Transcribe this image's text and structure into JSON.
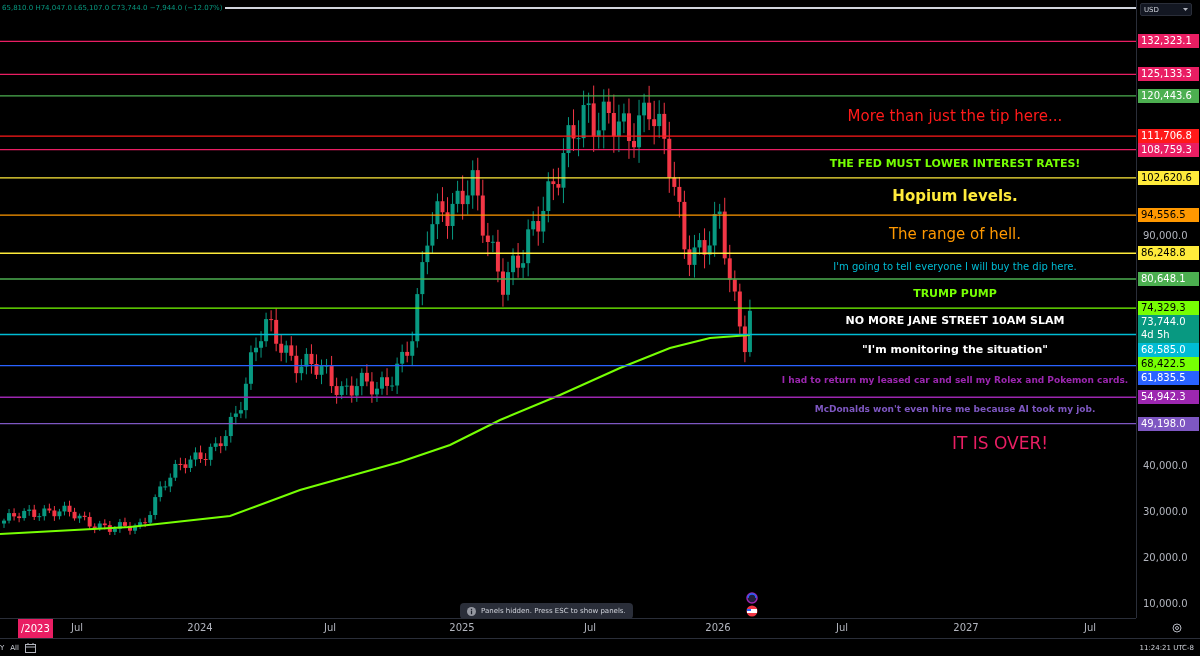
{
  "header": {
    "ohlc": "65,810.0 H74,047.0 L65,107.0 C73,744.0 −7,944.0 (−12.07%)"
  },
  "currency_selector": {
    "value": "USD"
  },
  "levels": [
    {
      "price": "132,323.1",
      "color": "#e91e63"
    },
    {
      "price": "125,133.3",
      "color": "#e91e63"
    },
    {
      "price": "120,443.6",
      "color": "#4caf50"
    },
    {
      "price": "111,706.8",
      "color": "#ff1a1a",
      "note": {
        "text": "More than just the tip here...",
        "color": "#ff1a1a"
      }
    },
    {
      "price": "108,759.3",
      "color": "#e91e63"
    },
    {
      "price": "102,620.6",
      "color": "#ffeb3b",
      "note": {
        "text": "THE FED MUST LOWER INTEREST RATES!",
        "color": "#76ff03"
      }
    },
    {
      "price": "94,556.5",
      "color": "#ff9800",
      "note": {
        "text": "Hopium levels.",
        "color": "#ffeb3b"
      }
    },
    {
      "price": "86,248.8",
      "color": "#ffeb3b",
      "note": {
        "text": "The range of hell.",
        "color": "#ff9800"
      }
    },
    {
      "price": "80,648.1",
      "color": "#4caf50",
      "note": {
        "text": "I'm going to tell everyone I will buy the dip here.",
        "color": "#00bcd4"
      }
    },
    {
      "price": "74,329.3",
      "color": "#76ff03",
      "note": {
        "text": "TRUMP PUMP",
        "color": "#76ff03"
      }
    },
    {
      "price": "68,585.0",
      "color": "#00bcd4",
      "note": {
        "text": "NO MORE JANE STREET 10AM SLAM",
        "color": "#ffffff"
      }
    },
    {
      "price": "61,835.5",
      "color": "#2962ff",
      "note": {
        "text": "\"I'm monitoring the situation\"",
        "color": "#ffffff"
      }
    },
    {
      "price": "54,942.3",
      "color": "#9c27b0",
      "note": {
        "text": "I had to return my leased car and sell my Rolex and Pokemon cards.",
        "color": "#9c27b0"
      }
    },
    {
      "price": "49,198.0",
      "color": "#7e57c2",
      "note": {
        "text": "McDonalds won't even hire me because AI took my job.",
        "color": "#7e57c2"
      }
    }
  ],
  "closing_note": {
    "text": "IT IS OVER!",
    "color": "#e91e63"
  },
  "moving_average_label": {
    "price": "68,422.5",
    "color": "#76ff03"
  },
  "current_price": {
    "price": "73,744.0",
    "countdown": "4d 5h",
    "color": "#089981"
  },
  "price_axis": [
    "90,000.0",
    "40,000.0",
    "30,000.0",
    "20,000.0",
    "10,000.0"
  ],
  "time_axis": [
    {
      "label": "/2023",
      "selected": true
    },
    {
      "label": "Jul",
      "selected": false
    },
    {
      "label": "2024",
      "selected": false
    },
    {
      "label": "Jul",
      "selected": false
    },
    {
      "label": "2025",
      "selected": false
    },
    {
      "label": "Jul",
      "selected": false
    },
    {
      "label": "2026",
      "selected": false
    },
    {
      "label": "Jul",
      "selected": false
    },
    {
      "label": "2027",
      "selected": false
    },
    {
      "label": "Jul",
      "selected": false
    }
  ],
  "toast": {
    "text": "Panels hidden. Press ESC to show panels."
  },
  "status_bar": {
    "range_left": "Y",
    "range_all": "All",
    "clock": "11:24:21 UTC-8"
  }
}
